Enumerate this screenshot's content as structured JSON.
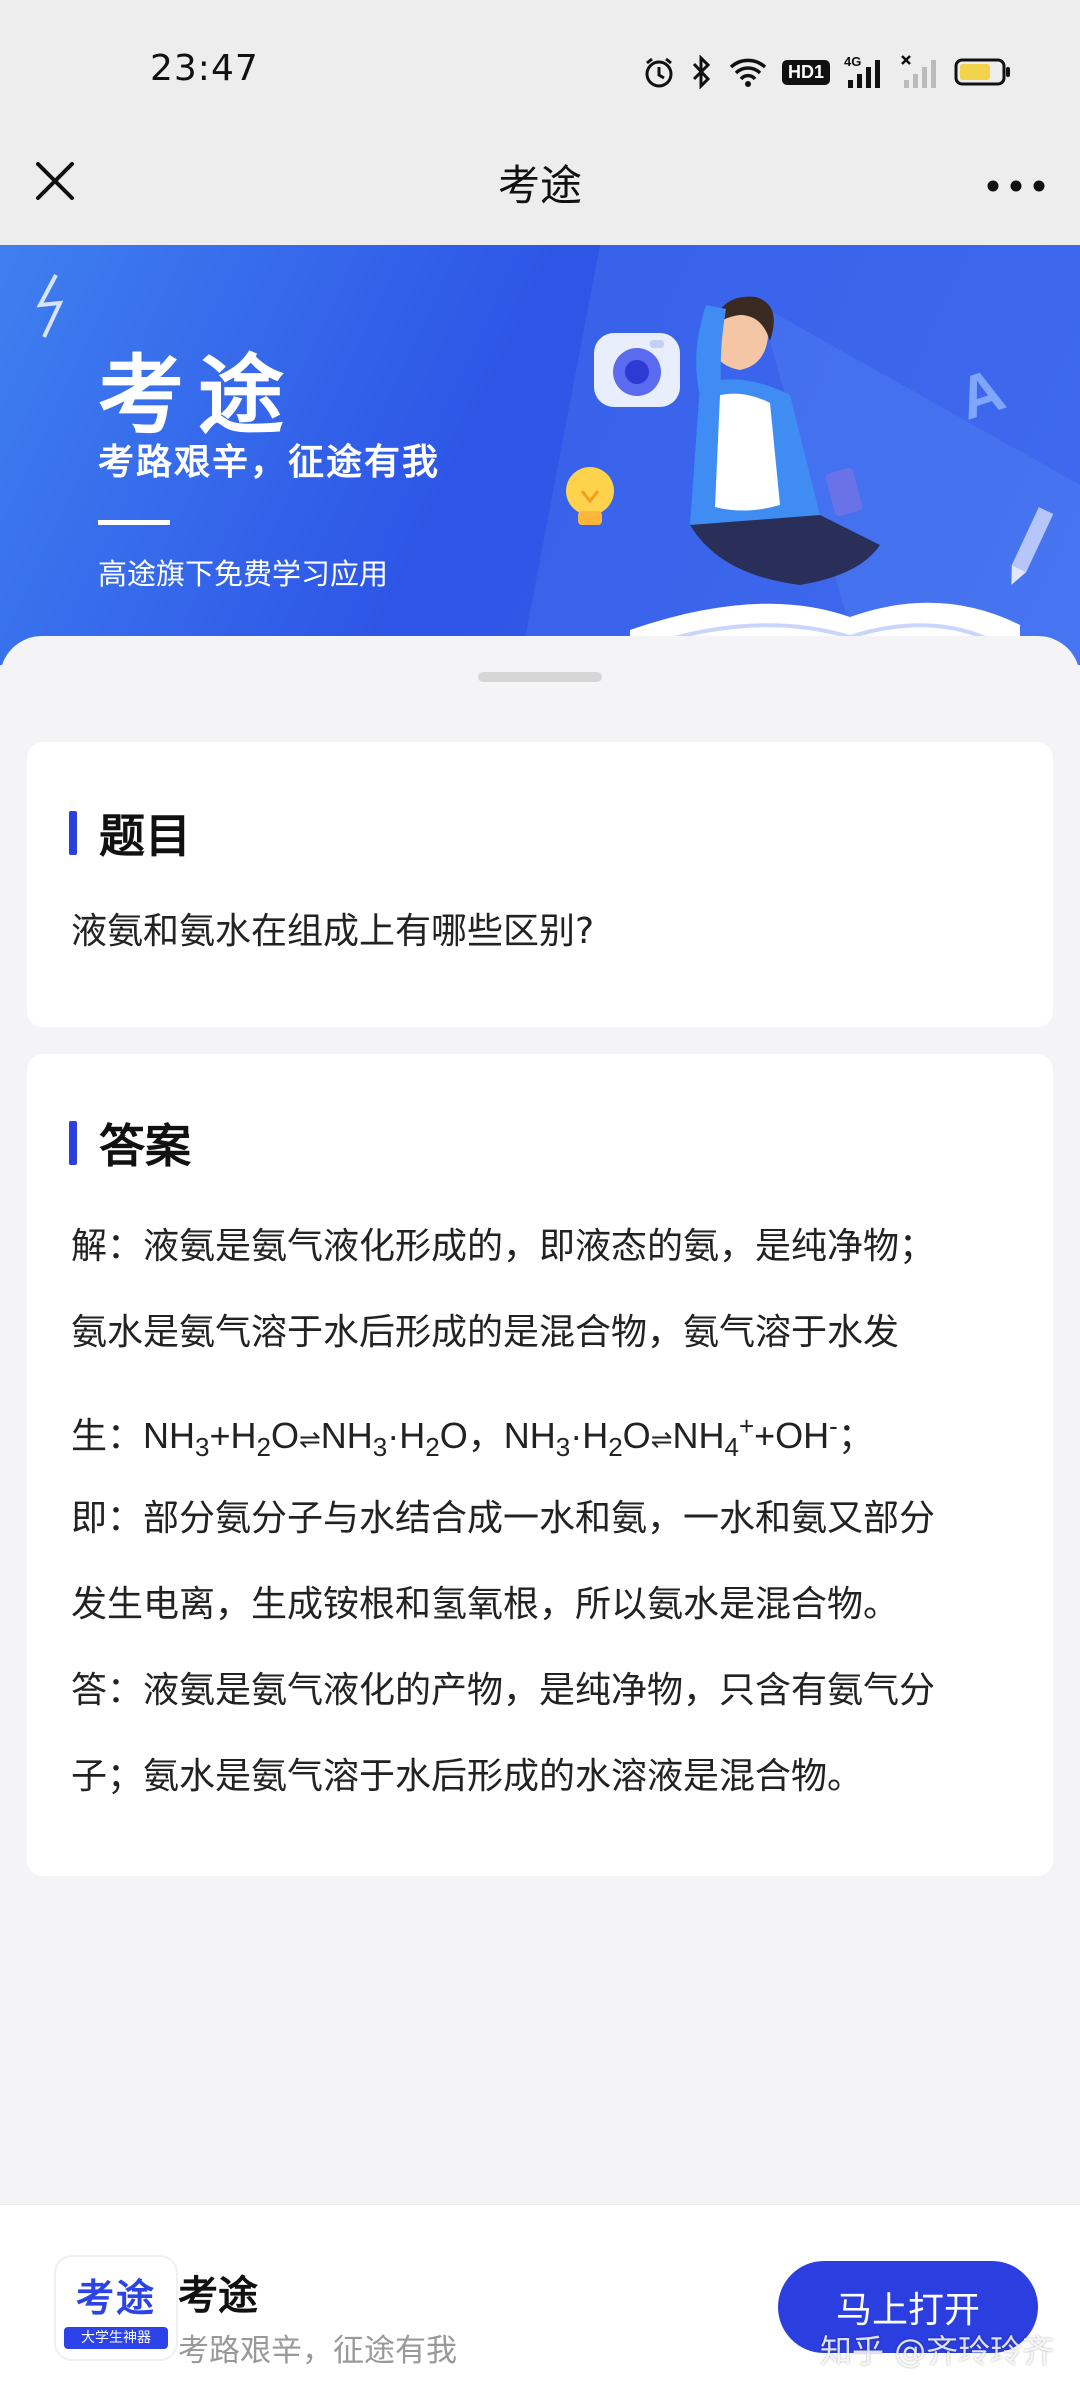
{
  "status_bar": {
    "time": "23:47",
    "icons": [
      "alarm-icon",
      "bluetooth-icon",
      "wifi-icon",
      "hd-badge",
      "4g-signal-icon",
      "signal-icon",
      "battery-icon"
    ],
    "hd_label": "HD1",
    "network_label": "4G"
  },
  "navbar": {
    "title": "考途",
    "close_icon": "close-icon",
    "more_icon": "more-icon"
  },
  "banner": {
    "title": "考途",
    "slogan": "考路艰辛，征途有我",
    "subtitle": "高途旗下免费学习应用"
  },
  "question": {
    "heading": "题目",
    "text": "液氨和氨水在组成上有哪些区别?"
  },
  "answer": {
    "heading": "答案",
    "line1": "解：液氨是氨气液化形成的，即液态的氨，是纯净物；",
    "line2": "氨水是氨气溶于水后形成的是混合物，氨气溶于水发",
    "formula_prefix": "生：",
    "line4": "即：部分氨分子与水结合成一水和氨，一水和氨又部分",
    "line5": "发生电离，生成铵根和氢氧根，所以氨水是混合物。",
    "line6": "答：液氨是氨气液化的产物，是纯净物，只含有氨气分",
    "line7": "子；氨水是氨气溶于水后形成的水溶液是混合物。"
  },
  "bottom_bar": {
    "logo_text": "考途",
    "logo_tag": "大学生神器",
    "app_name": "考途",
    "app_slogan": "考路艰辛，征途有我",
    "open_button": "马上打开"
  },
  "watermark": "知乎 @齐玲玲齐",
  "colors": {
    "accent": "#2b3ee0",
    "banner_blue": "#2d55e6",
    "background": "#f4f4f6"
  }
}
